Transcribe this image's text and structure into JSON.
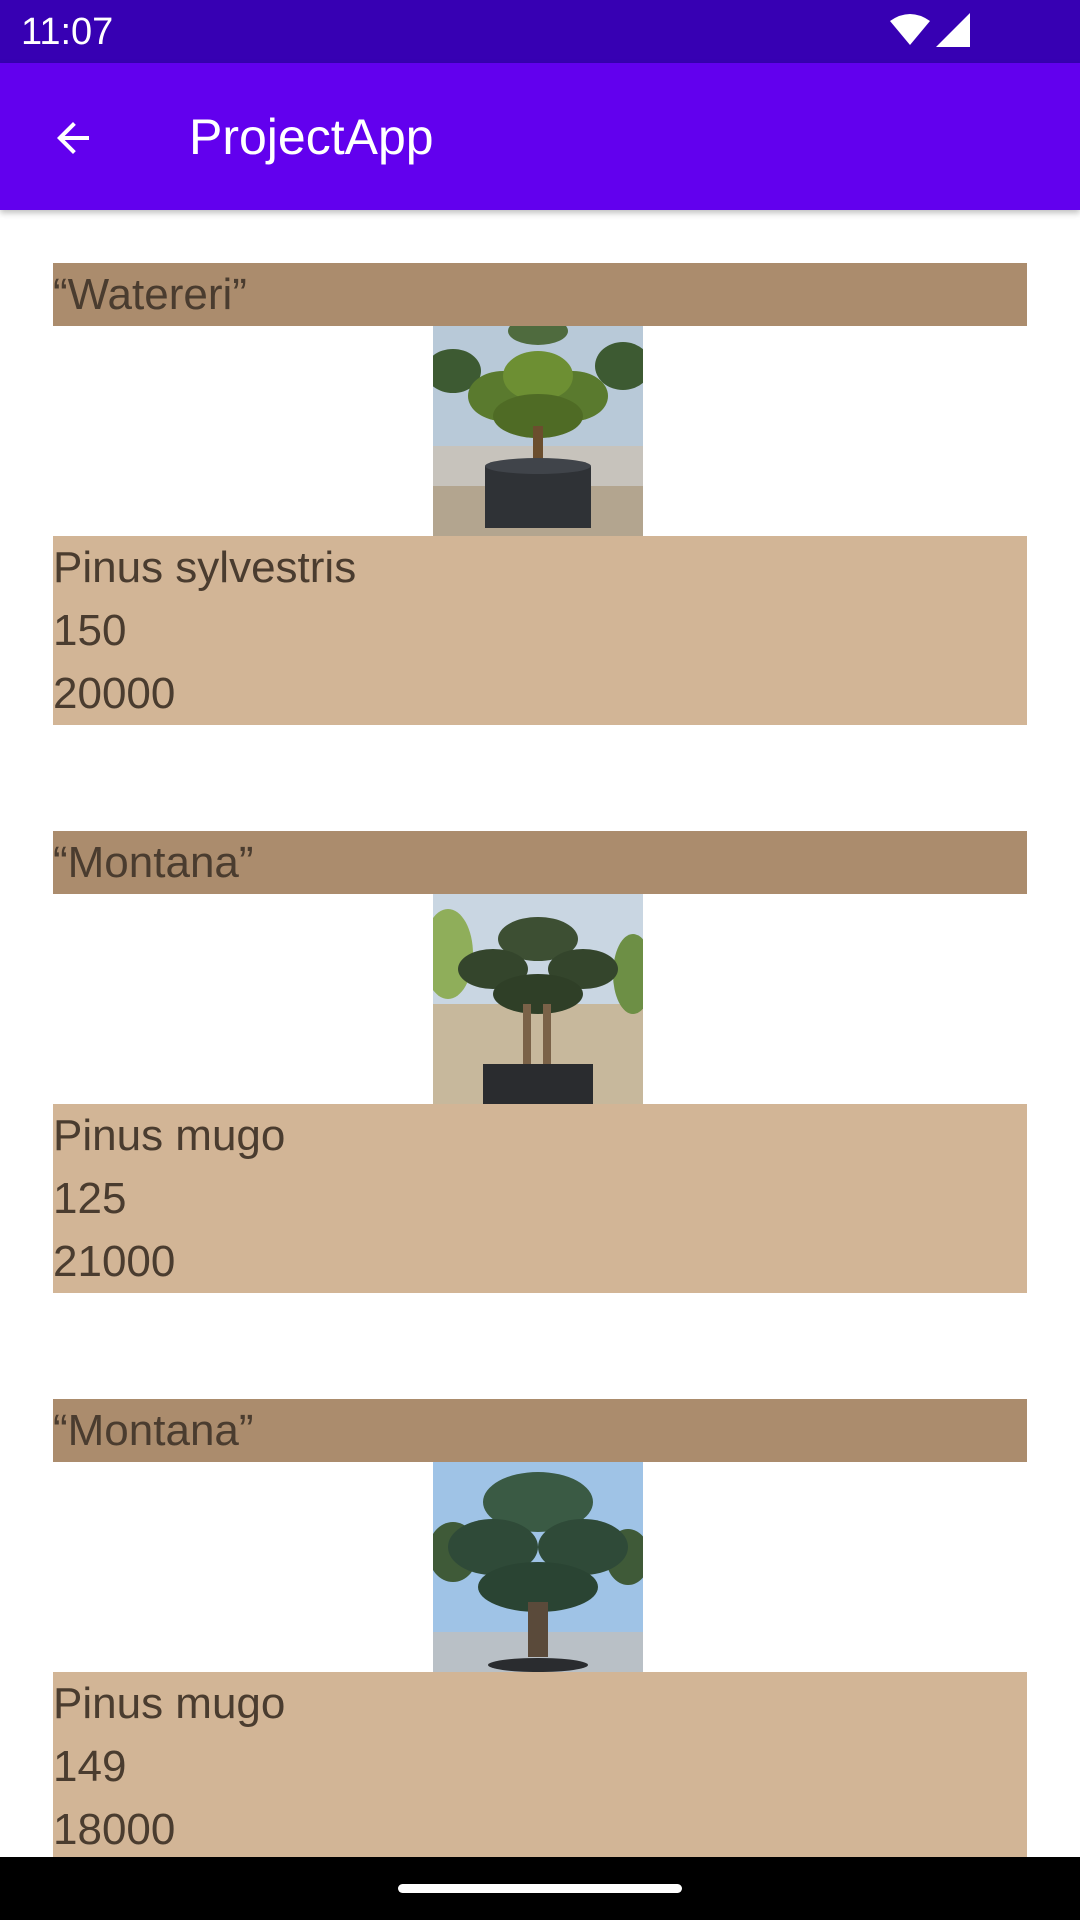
{
  "status_bar": {
    "time": "11:07",
    "icons": [
      "wifi-icon",
      "cell-signal-icon"
    ]
  },
  "app_bar": {
    "title": "ProjectApp",
    "back_icon": "arrow-back-icon"
  },
  "colors": {
    "status_bar": "#3700b3",
    "app_bar": "#6200ee",
    "card_header": "#ab8c6d",
    "card_details": "#d2b596",
    "card_text": "#4a3c2f"
  },
  "items": [
    {
      "name": "“Watereri”",
      "species": "Pinus sylvestris",
      "height": "150",
      "price": "20000"
    },
    {
      "name": " “Montana”",
      "species": "Pinus mugo",
      "height": "125",
      "price": "21000"
    },
    {
      "name": " “Montana”",
      "species": "Pinus mugo",
      "height": "149",
      "price": "18000"
    }
  ]
}
